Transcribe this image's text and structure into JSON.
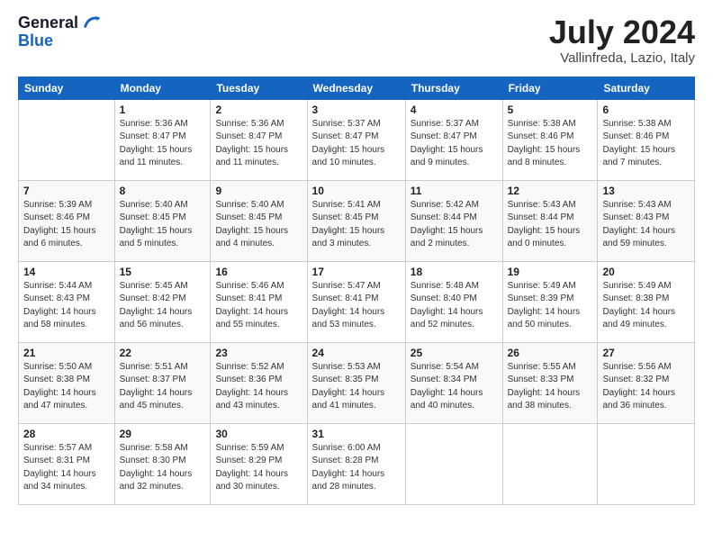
{
  "logo": {
    "general": "General",
    "blue": "Blue"
  },
  "title": "July 2024",
  "location": "Vallinfreda, Lazio, Italy",
  "days_of_week": [
    "Sunday",
    "Monday",
    "Tuesday",
    "Wednesday",
    "Thursday",
    "Friday",
    "Saturday"
  ],
  "weeks": [
    [
      {
        "day": "",
        "info": ""
      },
      {
        "day": "1",
        "info": "Sunrise: 5:36 AM\nSunset: 8:47 PM\nDaylight: 15 hours\nand 11 minutes."
      },
      {
        "day": "2",
        "info": "Sunrise: 5:36 AM\nSunset: 8:47 PM\nDaylight: 15 hours\nand 11 minutes."
      },
      {
        "day": "3",
        "info": "Sunrise: 5:37 AM\nSunset: 8:47 PM\nDaylight: 15 hours\nand 10 minutes."
      },
      {
        "day": "4",
        "info": "Sunrise: 5:37 AM\nSunset: 8:47 PM\nDaylight: 15 hours\nand 9 minutes."
      },
      {
        "day": "5",
        "info": "Sunrise: 5:38 AM\nSunset: 8:46 PM\nDaylight: 15 hours\nand 8 minutes."
      },
      {
        "day": "6",
        "info": "Sunrise: 5:38 AM\nSunset: 8:46 PM\nDaylight: 15 hours\nand 7 minutes."
      }
    ],
    [
      {
        "day": "7",
        "info": "Sunrise: 5:39 AM\nSunset: 8:46 PM\nDaylight: 15 hours\nand 6 minutes."
      },
      {
        "day": "8",
        "info": "Sunrise: 5:40 AM\nSunset: 8:45 PM\nDaylight: 15 hours\nand 5 minutes."
      },
      {
        "day": "9",
        "info": "Sunrise: 5:40 AM\nSunset: 8:45 PM\nDaylight: 15 hours\nand 4 minutes."
      },
      {
        "day": "10",
        "info": "Sunrise: 5:41 AM\nSunset: 8:45 PM\nDaylight: 15 hours\nand 3 minutes."
      },
      {
        "day": "11",
        "info": "Sunrise: 5:42 AM\nSunset: 8:44 PM\nDaylight: 15 hours\nand 2 minutes."
      },
      {
        "day": "12",
        "info": "Sunrise: 5:43 AM\nSunset: 8:44 PM\nDaylight: 15 hours\nand 0 minutes."
      },
      {
        "day": "13",
        "info": "Sunrise: 5:43 AM\nSunset: 8:43 PM\nDaylight: 14 hours\nand 59 minutes."
      }
    ],
    [
      {
        "day": "14",
        "info": "Sunrise: 5:44 AM\nSunset: 8:43 PM\nDaylight: 14 hours\nand 58 minutes."
      },
      {
        "day": "15",
        "info": "Sunrise: 5:45 AM\nSunset: 8:42 PM\nDaylight: 14 hours\nand 56 minutes."
      },
      {
        "day": "16",
        "info": "Sunrise: 5:46 AM\nSunset: 8:41 PM\nDaylight: 14 hours\nand 55 minutes."
      },
      {
        "day": "17",
        "info": "Sunrise: 5:47 AM\nSunset: 8:41 PM\nDaylight: 14 hours\nand 53 minutes."
      },
      {
        "day": "18",
        "info": "Sunrise: 5:48 AM\nSunset: 8:40 PM\nDaylight: 14 hours\nand 52 minutes."
      },
      {
        "day": "19",
        "info": "Sunrise: 5:49 AM\nSunset: 8:39 PM\nDaylight: 14 hours\nand 50 minutes."
      },
      {
        "day": "20",
        "info": "Sunrise: 5:49 AM\nSunset: 8:38 PM\nDaylight: 14 hours\nand 49 minutes."
      }
    ],
    [
      {
        "day": "21",
        "info": "Sunrise: 5:50 AM\nSunset: 8:38 PM\nDaylight: 14 hours\nand 47 minutes."
      },
      {
        "day": "22",
        "info": "Sunrise: 5:51 AM\nSunset: 8:37 PM\nDaylight: 14 hours\nand 45 minutes."
      },
      {
        "day": "23",
        "info": "Sunrise: 5:52 AM\nSunset: 8:36 PM\nDaylight: 14 hours\nand 43 minutes."
      },
      {
        "day": "24",
        "info": "Sunrise: 5:53 AM\nSunset: 8:35 PM\nDaylight: 14 hours\nand 41 minutes."
      },
      {
        "day": "25",
        "info": "Sunrise: 5:54 AM\nSunset: 8:34 PM\nDaylight: 14 hours\nand 40 minutes."
      },
      {
        "day": "26",
        "info": "Sunrise: 5:55 AM\nSunset: 8:33 PM\nDaylight: 14 hours\nand 38 minutes."
      },
      {
        "day": "27",
        "info": "Sunrise: 5:56 AM\nSunset: 8:32 PM\nDaylight: 14 hours\nand 36 minutes."
      }
    ],
    [
      {
        "day": "28",
        "info": "Sunrise: 5:57 AM\nSunset: 8:31 PM\nDaylight: 14 hours\nand 34 minutes."
      },
      {
        "day": "29",
        "info": "Sunrise: 5:58 AM\nSunset: 8:30 PM\nDaylight: 14 hours\nand 32 minutes."
      },
      {
        "day": "30",
        "info": "Sunrise: 5:59 AM\nSunset: 8:29 PM\nDaylight: 14 hours\nand 30 minutes."
      },
      {
        "day": "31",
        "info": "Sunrise: 6:00 AM\nSunset: 8:28 PM\nDaylight: 14 hours\nand 28 minutes."
      },
      {
        "day": "",
        "info": ""
      },
      {
        "day": "",
        "info": ""
      },
      {
        "day": "",
        "info": ""
      }
    ]
  ]
}
